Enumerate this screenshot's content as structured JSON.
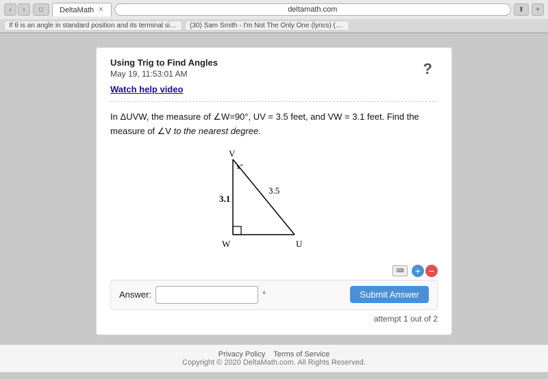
{
  "browser": {
    "tab_label": "DeltaMath",
    "address": "deltamath.com",
    "other_tab_1": "If θ is an angle in standard position and its terminal side passes through th...",
    "other_tab_2": "(30) Sam Smith - I'm Not The Only One (lyrics) (HD) - YouTube"
  },
  "page": {
    "section_title": "Using Trig to Find Angles",
    "date": "May 19, 11:53:01 AM",
    "watch_video": "Watch help video",
    "problem": {
      "intro": "In ΔUVW, the measure of ∠W=90°, UV = 3.5 feet, and VW = 3.1 feet. Find the measure of ∠V",
      "italic_part": "to the nearest degree",
      "end": ".",
      "triangle": {
        "vertex_v": "V",
        "vertex_w": "W",
        "vertex_u": "U",
        "angle_label": "x°",
        "side_vw": "3.1",
        "side_vu": "3.5"
      }
    },
    "answer": {
      "label": "Answer:",
      "placeholder": "",
      "degree_symbol": "°",
      "submit_label": "Submit Answer"
    },
    "attempt": "attempt 1 out of 2"
  },
  "footer": {
    "privacy": "Privacy Policy",
    "terms": "Terms of Service",
    "copyright": "Copyright © 2020 DeltaMath.com. All Rights Reserved."
  }
}
